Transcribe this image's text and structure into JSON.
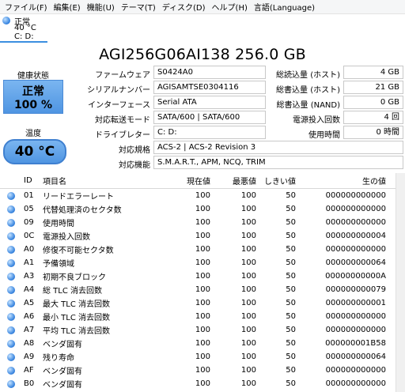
{
  "menu": [
    "ファイル(F)",
    "編集(E)",
    "機能(U)",
    "テーマ(T)",
    "ディスク(D)",
    "ヘルプ(H)",
    "言語(Language)"
  ],
  "drive_tab": {
    "status": "正常",
    "temp": "40 °C",
    "letter": "C: D:"
  },
  "title": "AGI256G06AI138 256.0 GB",
  "health": {
    "label": "健康状態",
    "status": "正常",
    "percent": "100 %"
  },
  "temperature": {
    "label": "温度",
    "value": "40 °C"
  },
  "info": {
    "firmware_label": "ファームウェア",
    "firmware": "S0424A0",
    "serial_label": "シリアルナンバー",
    "serial": "AGISAMTSE0304116",
    "interface_label": "インターフェース",
    "interface": "Serial ATA",
    "transfer_label": "対応転送モード",
    "transfer": "SATA/600 | SATA/600",
    "letter_label": "ドライブレター",
    "letter": "C: D:",
    "standard_label": "対応規格",
    "standard": "ACS-2 | ACS-2 Revision 3",
    "features_label": "対応機能",
    "features": "S.M.A.R.T., APM, NCQ, TRIM"
  },
  "stats": {
    "host_reads_label": "総読込量 (ホスト)",
    "host_reads": "4 GB",
    "host_writes_label": "総書込量 (ホスト)",
    "host_writes": "21 GB",
    "nand_writes_label": "総書込量 (NAND)",
    "nand_writes": "0 GB",
    "power_count_label": "電源投入回数",
    "power_count": "4 回",
    "power_hours_label": "使用時間",
    "power_hours": "0 時間"
  },
  "table": {
    "headers": [
      "ID",
      "項目名",
      "現在値",
      "最悪値",
      "しきい値",
      "生の値"
    ],
    "rows": [
      {
        "id": "01",
        "name": "リードエラーレート",
        "cur": "100",
        "worst": "100",
        "thr": "50",
        "raw": "000000000000"
      },
      {
        "id": "05",
        "name": "代替処理済のセクタ数",
        "cur": "100",
        "worst": "100",
        "thr": "50",
        "raw": "000000000000"
      },
      {
        "id": "09",
        "name": "使用時間",
        "cur": "100",
        "worst": "100",
        "thr": "50",
        "raw": "000000000000"
      },
      {
        "id": "0C",
        "name": "電源投入回数",
        "cur": "100",
        "worst": "100",
        "thr": "50",
        "raw": "000000000004"
      },
      {
        "id": "A0",
        "name": "修復不可能セクタ数",
        "cur": "100",
        "worst": "100",
        "thr": "50",
        "raw": "000000000000"
      },
      {
        "id": "A1",
        "name": "予備領域",
        "cur": "100",
        "worst": "100",
        "thr": "50",
        "raw": "000000000064"
      },
      {
        "id": "A3",
        "name": "初期不良ブロック",
        "cur": "100",
        "worst": "100",
        "thr": "50",
        "raw": "00000000000A"
      },
      {
        "id": "A4",
        "name": "総 TLC 消去回数",
        "cur": "100",
        "worst": "100",
        "thr": "50",
        "raw": "000000000079"
      },
      {
        "id": "A5",
        "name": "最大 TLC 消去回数",
        "cur": "100",
        "worst": "100",
        "thr": "50",
        "raw": "000000000001"
      },
      {
        "id": "A6",
        "name": "最小 TLC 消去回数",
        "cur": "100",
        "worst": "100",
        "thr": "50",
        "raw": "000000000000"
      },
      {
        "id": "A7",
        "name": "平均 TLC 消去回数",
        "cur": "100",
        "worst": "100",
        "thr": "50",
        "raw": "000000000000"
      },
      {
        "id": "A8",
        "name": "ベンダ固有",
        "cur": "100",
        "worst": "100",
        "thr": "50",
        "raw": "000000001B58"
      },
      {
        "id": "A9",
        "name": "残り寿命",
        "cur": "100",
        "worst": "100",
        "thr": "50",
        "raw": "000000000064"
      },
      {
        "id": "AF",
        "name": "ベンダ固有",
        "cur": "100",
        "worst": "100",
        "thr": "50",
        "raw": "000000000000"
      },
      {
        "id": "B0",
        "name": "ベンダ固有",
        "cur": "100",
        "worst": "100",
        "thr": "50",
        "raw": "000000000000"
      }
    ]
  },
  "colors": {
    "good": "#4f95e2",
    "tab_accent": "#3b8fe0"
  }
}
